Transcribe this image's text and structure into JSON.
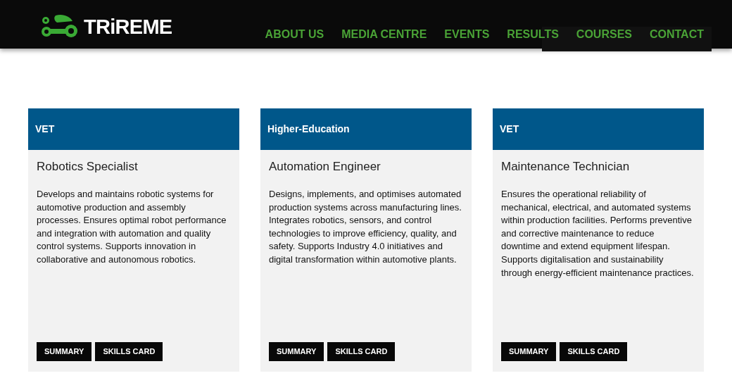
{
  "header": {
    "logo_text": "TRiREME",
    "nav": [
      {
        "label": "ABOUT US"
      },
      {
        "label": "MEDIA CENTRE"
      },
      {
        "label": "EVENTS"
      },
      {
        "label": "RESULTS"
      },
      {
        "label": "COURSES"
      },
      {
        "label": "CONTACT"
      }
    ]
  },
  "cards": [
    {
      "tag": "VET",
      "title": "Robotics Specialist",
      "description": "Develops and maintains robotic systems for automotive production and assembly processes. Ensures optimal robot performance and integration with automation and quality control systems. Supports innovation in collaborative and autonomous robotics.",
      "buttons": [
        "SUMMARY",
        "SKILLS CARD"
      ]
    },
    {
      "tag": "Higher-Education",
      "title": "Automation Engineer",
      "description": "Designs, implements, and optimises automated production systems across manufacturing lines. Integrates robotics, sensors, and control technologies to improve efficiency, quality, and safety. Supports Industry 4.0 initiatives and digital transformation within automotive plants.",
      "buttons": [
        "SUMMARY",
        "SKILLS CARD"
      ]
    },
    {
      "tag": "VET",
      "title": "Maintenance Technician",
      "description": "Ensures the operational reliability of mechanical, electrical, and automated systems within production facilities. Performs preventive and corrective maintenance to reduce downtime and extend equipment lifespan. Supports digitalisation and sustainability through energy-efficient maintenance practices.",
      "buttons": [
        "SUMMARY",
        "SKILLS CARD"
      ]
    }
  ]
}
